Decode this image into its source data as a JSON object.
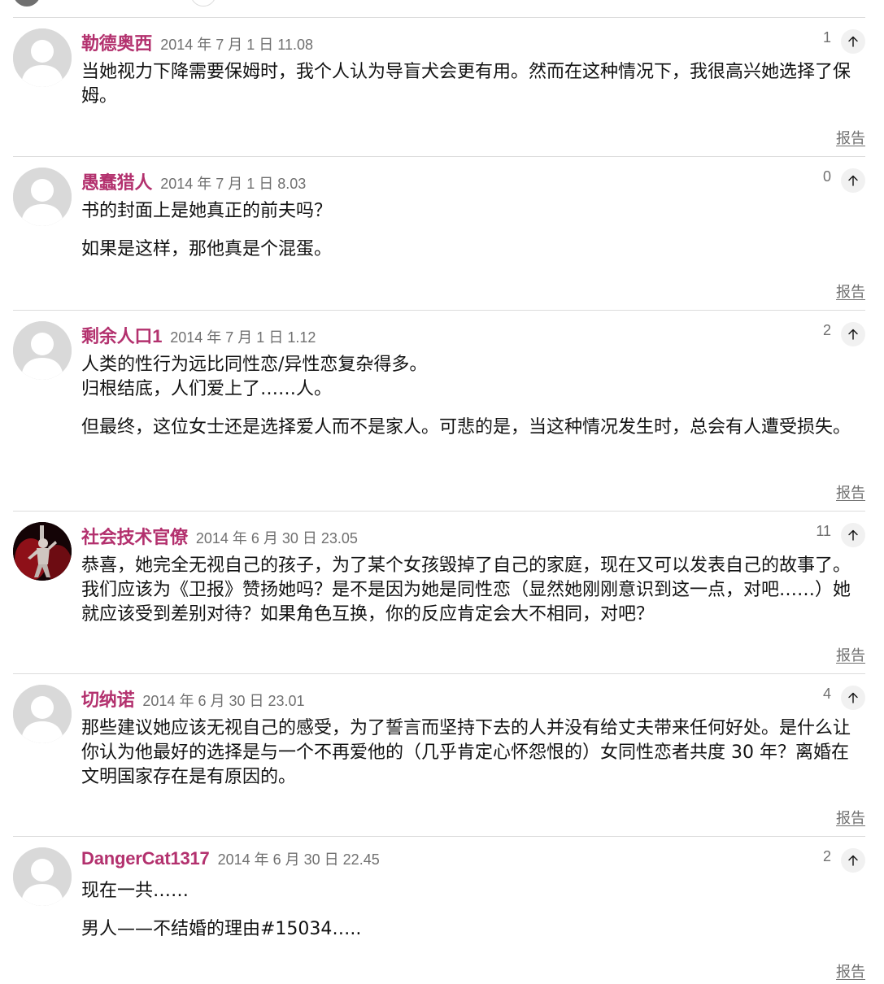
{
  "comments": [
    {
      "author": "勒德奥西",
      "date": "2014 年 7 月 1 日 11.08",
      "recommend_count": "1",
      "paragraphs": [
        "当她视力下降需要保姆时，我个人认为导盲犬会更有用。然而在这种情况下，我很高兴她选择了保姆。"
      ],
      "report_label": "报告",
      "avatar": "default-avatar-icon"
    },
    {
      "author": "愚蠢猎人",
      "date": "2014 年 7 月 1 日 8.03",
      "recommend_count": "0",
      "paragraphs": [
        "书的封面上是她真正的前夫吗？",
        "如果是这样，那他真是个混蛋。"
      ],
      "report_label": "报告",
      "avatar": "default-avatar-icon"
    },
    {
      "author": "剩余人口1",
      "date": "2014 年 7 月 1 日 1.12",
      "recommend_count": "2",
      "paragraphs": [
        "人类的性行为远比同性恋/异性恋复杂得多。",
        "归根结底，人们爱上了……人。",
        "但最终，这位女士还是选择爱人而不是家人。可悲的是，当这种情况发生时，总会有人遭受损失。"
      ],
      "report_label": "报告",
      "avatar": "default-avatar-icon"
    },
    {
      "author": "社会技术官僚",
      "date": "2014 年 6 月 30 日 23.05",
      "recommend_count": "11",
      "paragraphs": [
        "恭喜，她完全无视自己的孩子，为了某个女孩毁掉了自己的家庭，现在又可以发表自己的故事了。我们应该为《卫报》赞扬她吗？是不是因为她是同性恋（显然她刚刚意识到这一点，对吧……）她就应该受到差别对待？如果角色互换，你的反应肯定会大不相同，对吧？"
      ],
      "report_label": "报告",
      "avatar": "photo-avatar"
    },
    {
      "author": "切纳诺",
      "date": "2014 年 6 月 30 日 23.01",
      "recommend_count": "4",
      "paragraphs": [
        "那些建议她应该无视自己的感受，为了誓言而坚持下去的人并没有给丈夫带来任何好处。是什么让你认为他最好的选择是与一个不再爱他的（几乎肯定心怀怨恨的）女同性恋者共度 30 年？离婚在文明国家存在是有原因的。"
      ],
      "report_label": "报告",
      "avatar": "default-avatar-icon"
    },
    {
      "author": "DangerCat1317",
      "date": "2014 年 6 月 30 日 22.45",
      "recommend_count": "2",
      "paragraphs": [
        "现在一共……",
        "男人——不结婚的理由#15034….."
      ],
      "report_label": "报告",
      "avatar": "default-avatar-icon"
    }
  ],
  "colors": {
    "author": "#b3316e",
    "meta": "#707070",
    "divider": "#dcdcdc",
    "avatar_bg": "#d9d9d9",
    "avatar_fg": "#ffffff"
  }
}
